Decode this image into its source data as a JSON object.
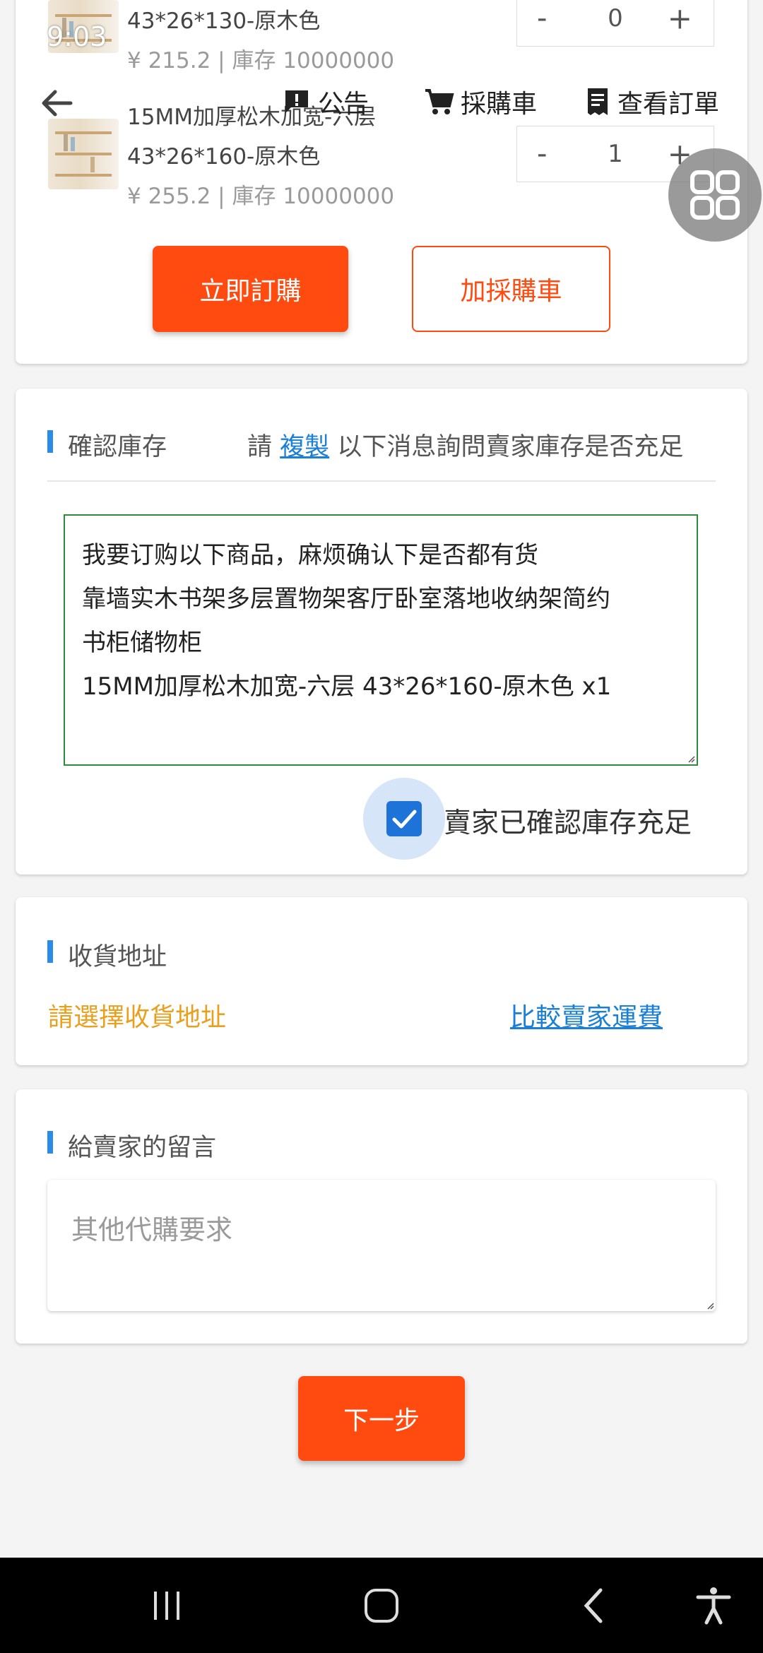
{
  "status_bar": {
    "time_fragment": "9:03"
  },
  "top_nav": {
    "announcement": "公告",
    "cart": "採購車",
    "orders": "查看訂單"
  },
  "products": [
    {
      "name_line1": "",
      "name_line2": "43*26*130-原木色",
      "price": "¥ 215.2 | 庫存 10000000",
      "qty": "0"
    },
    {
      "name_line1": "15MM加厚松木加宽-六层",
      "name_line2": "43*26*160-原木色",
      "price": "¥ 255.2 | 庫存 10000000",
      "qty": "1"
    }
  ],
  "stepper": {
    "minus": "-",
    "plus": "+"
  },
  "actions": {
    "buy_now": "立即訂購",
    "add_cart": "加採購車"
  },
  "stock_section": {
    "title": "確認庫存",
    "hint_prefix": "請",
    "hint_link": "複製",
    "hint_suffix": "以下消息詢問賣家庫存是否充足",
    "message_lines": [
      "我要订购以下商品，麻烦确认下是否都有货",
      "靠墙实木书架多层置物架客厅卧室落地收纳架简约",
      "书柜储物柜",
      "15MM加厚松木加宽-六层 43*26*160-原木色 x1"
    ],
    "confirm_label": "賣家已確認庫存充足",
    "confirmed": true
  },
  "address_section": {
    "title": "收貨地址",
    "select": "請選擇收貨地址",
    "compare": "比較賣家運費"
  },
  "message_section": {
    "title": "給賣家的留言",
    "placeholder": "其他代購要求"
  },
  "next_button": "下一步",
  "colors": {
    "accent": "#ff4a10",
    "link": "#1a7fd6",
    "warning": "#e8a01e",
    "section_bar": "#2b8be8",
    "checkbox": "#1e73d9"
  },
  "icons": {
    "back": "arrow-left-icon",
    "announcement": "announcement-icon",
    "cart": "cart-icon",
    "orders": "receipt-icon",
    "floating": "grid-icon"
  }
}
